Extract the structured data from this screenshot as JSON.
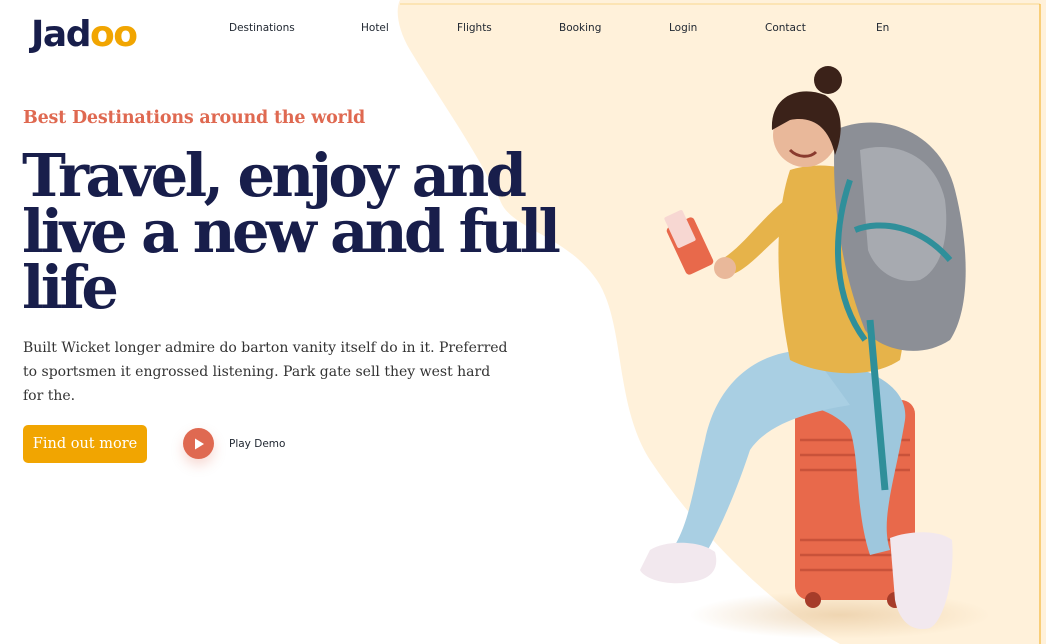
{
  "brand": {
    "logo_prefix": "Jad",
    "logo_accent": "oo"
  },
  "nav": {
    "items": [
      {
        "label": "Destinations"
      },
      {
        "label": "Hotel"
      },
      {
        "label": "Flights"
      },
      {
        "label": "Booking"
      },
      {
        "label": "Login"
      },
      {
        "label": "Contact"
      },
      {
        "label": "En"
      }
    ]
  },
  "hero": {
    "tagline": "Best Destinations around the world",
    "headline_lines": [
      "Travel, enjoy and",
      "live a new and full",
      "life"
    ],
    "body": "Built Wicket longer admire do barton vanity itself do in it. Preferred to sportsmen it engrossed listening. Park gate sell they west hard for the.",
    "cta_label": "Find out more",
    "play_label": "Play Demo"
  },
  "colors": {
    "primary": "#181e4b",
    "accent_orange": "#df6951",
    "accent_yellow": "#f1a501",
    "blob": "#fff1da"
  },
  "icons": {
    "play": "play-icon"
  }
}
